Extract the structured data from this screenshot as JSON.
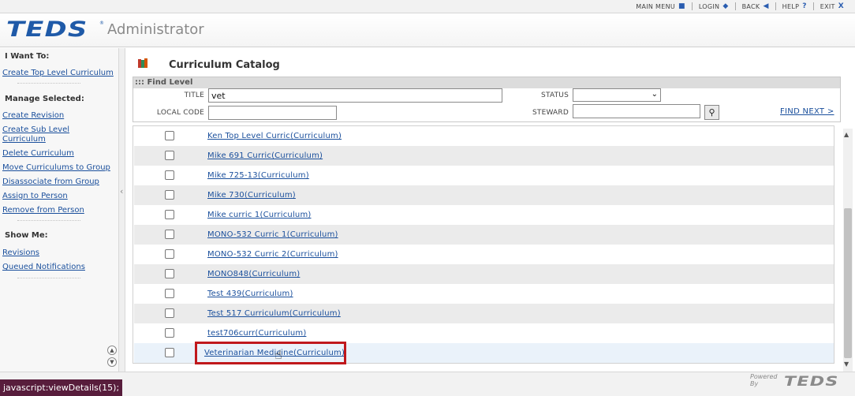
{
  "topnav": {
    "items": [
      {
        "label": "MAIN MENU",
        "icon": "■"
      },
      {
        "label": "LOGIN",
        "icon": "◆"
      },
      {
        "label": "BACK",
        "icon": "◀"
      },
      {
        "label": "HELP",
        "icon": "?"
      },
      {
        "label": "EXIT",
        "icon": "X"
      }
    ]
  },
  "header": {
    "logo": "TEDS",
    "logo_reg": "®",
    "app_title": "Administrator"
  },
  "sidebar": {
    "heading_want": "I Want To:",
    "link_create_top": "Create Top Level Curriculum",
    "heading_manage": "Manage Selected:",
    "manage_links": [
      "Create Revision",
      "Create Sub Level Curriculum",
      "Delete Curriculum",
      "Move Curriculums to Group",
      "Disassociate from Group",
      "Assign to Person",
      "Remove from Person"
    ],
    "heading_show": "Show Me:",
    "show_links": [
      "Revisions",
      "Queued Notifications"
    ]
  },
  "page": {
    "title": "Curriculum Catalog"
  },
  "find": {
    "header": "::: Find Level",
    "title_label": "TITLE",
    "title_value": "vet",
    "local_code_label": "LOCAL CODE",
    "local_code_value": "",
    "status_label": "STATUS",
    "status_value": "",
    "steward_label": "STEWARD",
    "steward_value": "",
    "find_next": "FIND NEXT >"
  },
  "results": [
    "Ken Top Level Curric(Curriculum)",
    "Mike 691 Curric(Curriculum)",
    "Mike 725-13(Curriculum)",
    "Mike 730(Curriculum)",
    "Mike curric 1(Curriculum)",
    "MONO-532 Curric 1(Curriculum)",
    "MONO-532 Curric 2(Curriculum)",
    "MONO848(Curriculum)",
    "Test 439(Curriculum)",
    "Test 517 Curriculum(Curriculum)",
    "test706curr(Curriculum)",
    "Veterinarian Medicine(Curriculum)"
  ],
  "footer": {
    "powered_by": "Powered By",
    "logo": "TEDS",
    "status_url": "javascript:viewDetails(15);"
  },
  "colors": {
    "accent": "#1f5aa8",
    "link": "#1a4f9c",
    "highlight": "#c0181c",
    "status_bar": "#581d3c"
  }
}
